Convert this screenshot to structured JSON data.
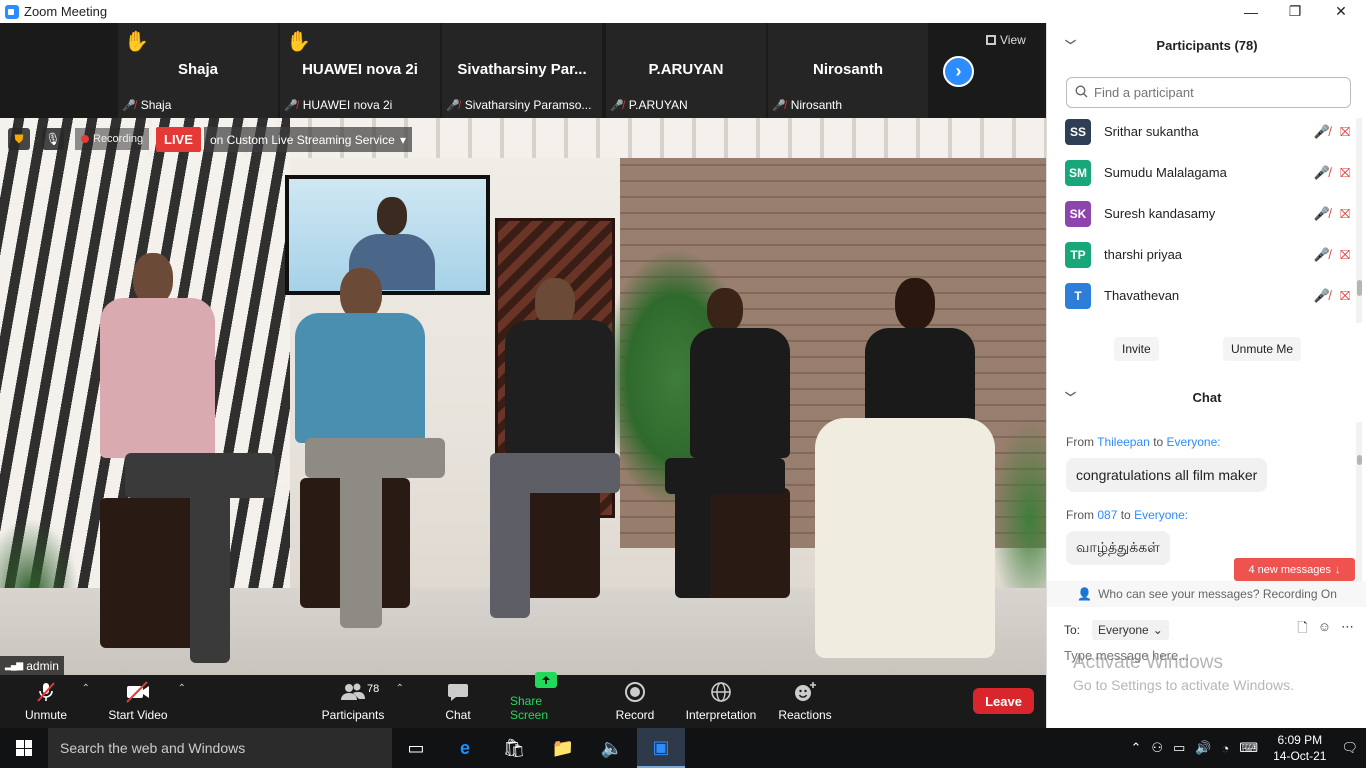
{
  "window": {
    "title": "Zoom Meeting",
    "controls": [
      "—",
      "❐",
      "✕"
    ]
  },
  "strip": {
    "tiles": [
      {
        "big": "Shaja",
        "small": "Shaja",
        "hand": true
      },
      {
        "big": "HUAWEI nova 2i",
        "small": "HUAWEI nova 2i",
        "hand": true
      },
      {
        "big": "Sivatharsiny  Par...",
        "small": "Sivatharsiny Paramso...",
        "hand": false
      },
      {
        "big": "P.ARUYAN",
        "small": "P.ARUYAN",
        "hand": false
      },
      {
        "big": "Nirosanth",
        "small": "Nirosanth",
        "hand": false
      }
    ],
    "view_label": "View"
  },
  "video_overlay": {
    "recording": "Recording",
    "live": "LIVE",
    "stream": "on Custom Live Streaming Service",
    "admin": "admin"
  },
  "toolbar": {
    "unmute": "Unmute",
    "start_video": "Start Video",
    "participants": "Participants",
    "participants_count": "78",
    "chat": "Chat",
    "share_screen": "Share Screen",
    "record": "Record",
    "interpretation": "Interpretation",
    "reactions": "Reactions",
    "leave": "Leave"
  },
  "participants_panel": {
    "title": "Participants (78)",
    "search_placeholder": "Find a participant",
    "list": [
      {
        "initials": "SS",
        "name": "Srithar sukantha",
        "color": "#2e3f55"
      },
      {
        "initials": "SM",
        "name": "Sumudu Malalagama",
        "color": "#17a77a"
      },
      {
        "initials": "SK",
        "name": "Suresh kandasamy",
        "color": "#8e44ad"
      },
      {
        "initials": "TP",
        "name": "tharshi priyaa",
        "color": "#17a77a"
      },
      {
        "initials": "T",
        "name": "Thavathevan",
        "color": "#2d7ed8"
      }
    ],
    "invite": "Invite",
    "unmute_me": "Unmute Me"
  },
  "chat_panel": {
    "title": "Chat",
    "messages": [
      {
        "from_label": "From",
        "from": "Thileepan",
        "to_label": "to",
        "to": "Everyone:",
        "text": "congratulations all film maker"
      },
      {
        "from_label": "From",
        "from": "087",
        "to_label": "to",
        "to": "Everyone:",
        "text": "வாழ்த்துக்கள்"
      }
    ],
    "new_messages": "4 new messages",
    "who_can_see": "Who can see your messages? Recording On",
    "to_label": "To:",
    "to_value": "Everyone",
    "input_placeholder": "Type message here..."
  },
  "activate_windows": {
    "line1": "Activate Windows",
    "line2": "Go to Settings to activate Windows."
  },
  "taskbar": {
    "search_text": "Search the web and Windows",
    "time": "6:09 PM",
    "date": "14-Oct-21"
  }
}
